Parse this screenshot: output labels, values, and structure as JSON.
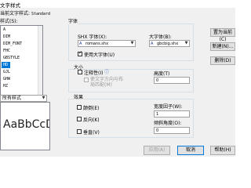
{
  "window": {
    "title": "文字样式"
  },
  "current_style": {
    "label": "当前文字样式:",
    "value": "Standard"
  },
  "styles": {
    "label": "样式(S):",
    "items": [
      "A",
      "DIM",
      "DIM_FONT",
      "FHC",
      "GBSTYLE",
      "HD",
      "GJL",
      "GHW",
      "HZ"
    ],
    "selected_index": 5
  },
  "list_filter": {
    "value": "所有样式"
  },
  "preview": {
    "text": "AaBbCcD_"
  },
  "font": {
    "group_label": "字体",
    "shx_label": "SHX 字体(X):",
    "shx_value": "romans.shx",
    "big_label": "大字体(B):",
    "big_value": "gbcbig.shx",
    "use_big_font_label": "使用大字体(U)",
    "use_big_font_checked": true
  },
  "size": {
    "group_label": "大小",
    "annotative_label": "注释性(I)",
    "annotative_checked": false,
    "match_orientation_label": "使文字方向与布局匹配(M)",
    "height_label": "高度(T)",
    "height_value": "0"
  },
  "effects": {
    "group_label": "效果",
    "upside_down_label": "颠倒(E)",
    "backwards_label": "反向(K)",
    "vertical_label": "垂直(V)",
    "width_factor_label": "宽度因子(W):",
    "width_factor_value": "1",
    "oblique_label": "倾斜角度(O):",
    "oblique_value": "0"
  },
  "buttons": {
    "set_current": "置为当前(C)",
    "new": "新建(N)...",
    "delete": "删除(D)",
    "apply": "应用(A)",
    "cancel": "取消",
    "help": "帮助(H)"
  }
}
